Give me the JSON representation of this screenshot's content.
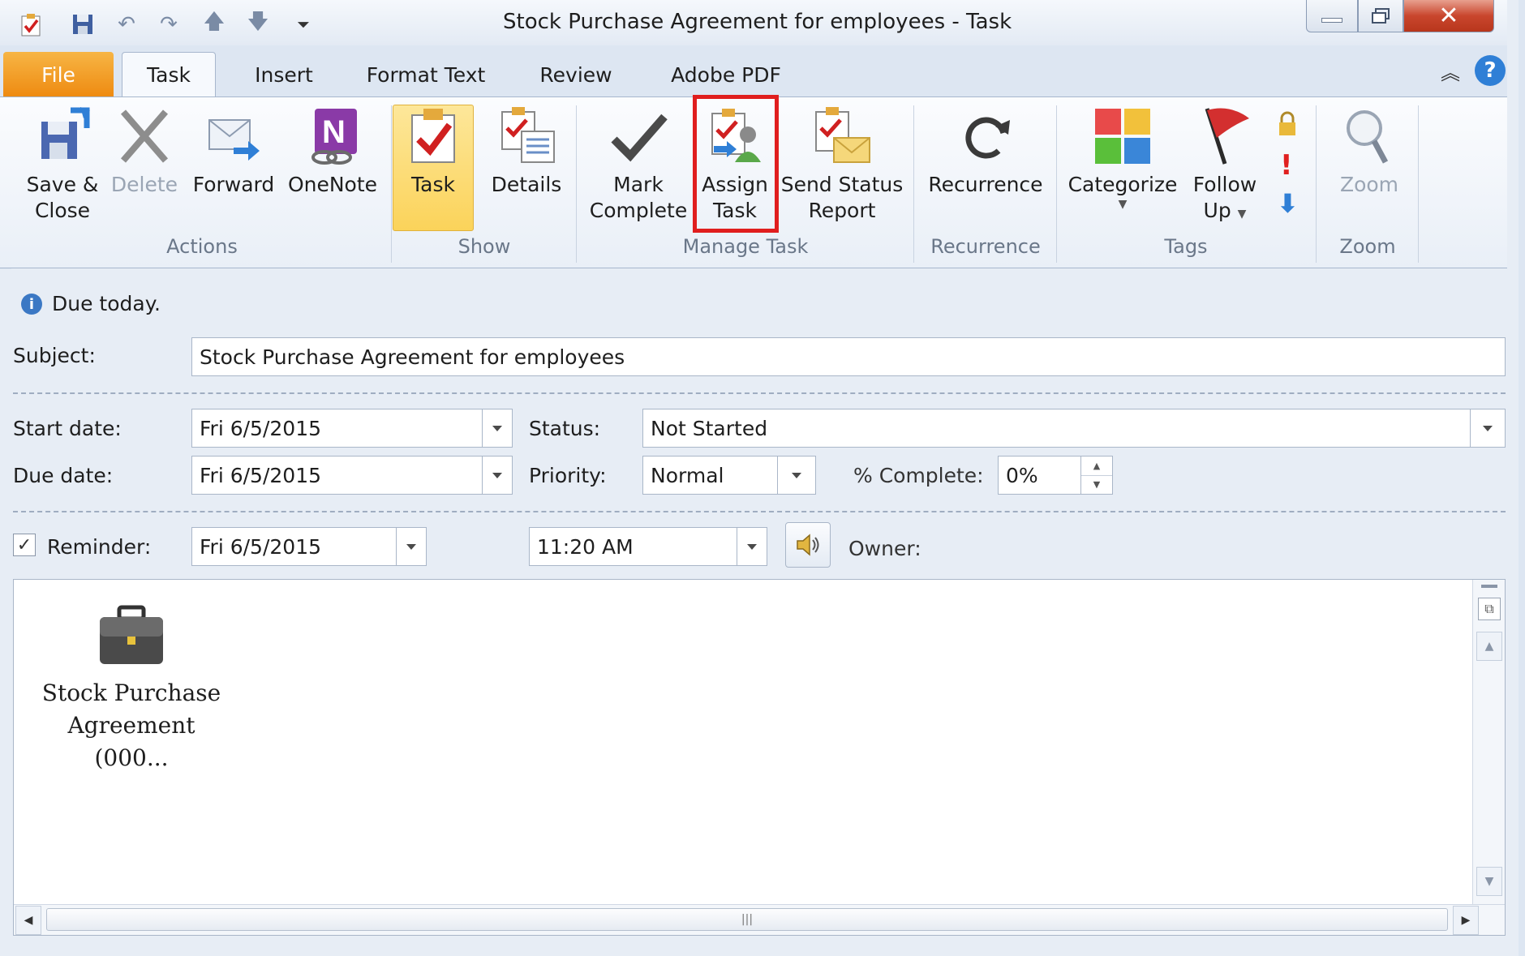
{
  "window": {
    "title": "Stock Purchase Agreement for employees  -  Task"
  },
  "quick_access": [
    "task-icon",
    "save-icon",
    "undo-icon",
    "redo-icon",
    "up-icon",
    "down-icon",
    "customize-icon"
  ],
  "tabs": [
    {
      "label": "File"
    },
    {
      "label": "Task"
    },
    {
      "label": "Insert"
    },
    {
      "label": "Format Text"
    },
    {
      "label": "Review"
    },
    {
      "label": "Adobe PDF"
    }
  ],
  "ribbon": {
    "groups": {
      "actions": "Actions",
      "show": "Show",
      "manage_task": "Manage Task",
      "recurrence": "Recurrence",
      "tags": "Tags",
      "zoom": "Zoom"
    },
    "buttons": {
      "save_close_1": "Save &",
      "save_close_2": "Close",
      "delete": "Delete",
      "forward": "Forward",
      "onenote": "OneNote",
      "task": "Task",
      "details": "Details",
      "mark_complete_1": "Mark",
      "mark_complete_2": "Complete",
      "assign_task_1": "Assign",
      "assign_task_2": "Task",
      "send_status_1": "Send Status",
      "send_status_2": "Report",
      "recurrence": "Recurrence",
      "categorize": "Categorize",
      "follow_up_1": "Follow",
      "follow_up_2": "Up",
      "zoom": "Zoom"
    }
  },
  "form": {
    "info": "Due today.",
    "subject_label": "Subject:",
    "subject_value": "Stock Purchase Agreement for employees",
    "start_label": "Start date:",
    "start_value": "Fri 6/5/2015",
    "due_label": "Due date:",
    "due_value": "Fri 6/5/2015",
    "status_label": "Status:",
    "status_value": "Not Started",
    "priority_label": "Priority:",
    "priority_value": "Normal",
    "complete_label": "% Complete:",
    "complete_value": "0%",
    "reminder_label": "Reminder:",
    "reminder_date": "Fri 6/5/2015",
    "reminder_time": "11:20 AM",
    "owner_label": "Owner:",
    "attachment_line1": "Stock Purchase",
    "attachment_line2": "Agreement (000..."
  },
  "colors": {
    "file_tab": "#ee8a10",
    "highlight_box": "#e01e1e",
    "active_button": "#fbd35a"
  }
}
